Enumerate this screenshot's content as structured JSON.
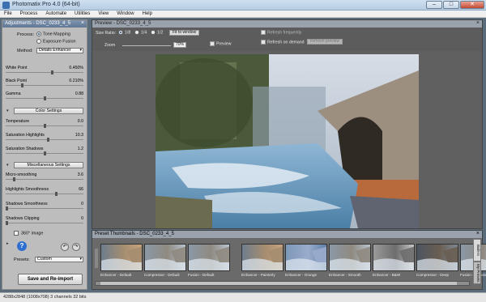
{
  "window": {
    "title": "Photomatix Pro 4.0 (64-bit)"
  },
  "menu": [
    "File",
    "Process",
    "Automate",
    "Utilities",
    "View",
    "Window",
    "Help"
  ],
  "adjustments": {
    "title": "Adjustments - DSC_0233_4_5",
    "process_label": "Process:",
    "process_options": [
      "Tone Mapping",
      "Exposure Fusion"
    ],
    "method_label": "Method:",
    "method_value": "Details Enhancer",
    "sliders_top": [
      {
        "label": "White Point",
        "value": "0.450%",
        "fraction": 0.6
      },
      {
        "label": "Black Point",
        "value": "0.210%",
        "fraction": 0.2
      },
      {
        "label": "Gamma",
        "value": "0.88",
        "fraction": 0.5
      }
    ],
    "color_settings_label": "Color Settings",
    "sliders_color": [
      {
        "label": "Temperature",
        "value": "0.0",
        "fraction": 0.5
      },
      {
        "label": "Saturation Highlights",
        "value": "10.3",
        "fraction": 0.55
      },
      {
        "label": "Saturation Shadows",
        "value": "1.2",
        "fraction": 0.5
      }
    ],
    "misc_settings_label": "Miscellaneous Settings",
    "sliders_misc": [
      {
        "label": "Micro-smoothing",
        "value": "3.6",
        "fraction": 0.1
      },
      {
        "label": "Highlights Smoothness",
        "value": "66",
        "fraction": 0.66
      },
      {
        "label": "Shadows Smoothness",
        "value": "0",
        "fraction": 0.0
      },
      {
        "label": "Shadows Clipping",
        "value": "0",
        "fraction": 0.0
      }
    ],
    "image360_label": "360° image",
    "presets_label": "Presets:",
    "presets_value": "Custom",
    "save_button": "Save and Re-import",
    "help_glyph": "?",
    "undo_glyph": "↶",
    "redo_glyph": "↷",
    "close_glyph": "×",
    "expand_glyph": "▸",
    "collapse_glyph": "▾"
  },
  "preview": {
    "title": "Preview - DSC_0233_4_5",
    "size_ratio_label": "Size Ratio:",
    "ratios": [
      "1/8",
      "1/4",
      "1/2"
    ],
    "fit_button": "Fit to window",
    "zoom_label": "Zoom",
    "zoom_value": "70%",
    "preview_label": "Preview",
    "refresh_label": "Refresh on demand",
    "refresh_button": "Refresh preview",
    "refresh_when_label": "Refresh frequently",
    "close_glyph": "×"
  },
  "thumbnails": {
    "title": "Preset Thumbnails - DSC_0233_4_5",
    "close_glyph": "×",
    "items": [
      {
        "label": "Enhancer - Default",
        "tone": "warm"
      },
      {
        "label": "Compressor - Default",
        "tone": "neutral"
      },
      {
        "label": "Fusion - Default",
        "tone": "neutral"
      },
      {
        "label": "Enhancer - Painterly",
        "tone": "warm"
      },
      {
        "label": "Enhancer - Grunge",
        "tone": "blue"
      },
      {
        "label": "Enhancer - Smooth",
        "tone": "neutral"
      },
      {
        "label": "Enhancer - B&W",
        "tone": "bw"
      },
      {
        "label": "Compressor - Deep",
        "tone": "dark"
      },
      {
        "label": "Fusion - Natural",
        "tone": "neutral"
      }
    ],
    "side_tabs": [
      "Built-In",
      "My Presets"
    ]
  },
  "status": {
    "text": "4288x2848 (1008x708) 3 channels 32 bits"
  }
}
